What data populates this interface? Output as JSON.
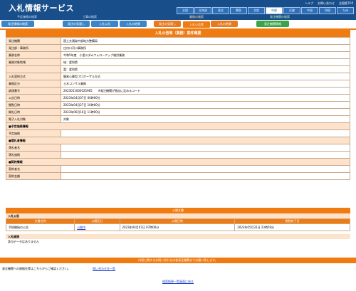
{
  "header": {
    "title": "入札情報サービス",
    "links": [
      "ヘルプ",
      "お問い合わせ",
      "全国版TOP"
    ],
    "regions": [
      "全国",
      "北海道",
      "東北",
      "関東",
      "北陸",
      "中部",
      "近畿",
      "中国",
      "四国",
      "九州"
    ]
  },
  "search_groups": [
    {
      "label": "予定価格の検索"
    },
    {
      "label": "工事の検索"
    },
    {
      "label": "業務の検索"
    },
    {
      "label": "発注機関の検索"
    }
  ],
  "nav": [
    "発注情報の検索",
    "発注の見通し",
    "入札公告",
    "入札の結果",
    "入札公告等",
    "入札の結果",
    "発注の見通し",
    "発注機関情報"
  ],
  "detail": {
    "title": "入札公告等（業務）案件概要",
    "rows": [
      {
        "k": "発注機関",
        "v": "国土交通省中部地方整備局"
      },
      {
        "k": "発注部・事務所",
        "v": "庄内川河川事務所"
      },
      {
        "k": "業務名称",
        "v": "令和5年度　小里川ダムフォローアップ検討業務"
      },
      {
        "k": "業務対象地域",
        "v": "岐：愛知県"
      },
      {
        "k": "",
        "v": "富：愛知県"
      },
      {
        "k": "入札契約方式",
        "v": "簡易公募型プロポーザル方式"
      },
      {
        "k": "業務区分",
        "v": "土木コンサル業務"
      },
      {
        "k": "調達番号",
        "v": "2023051000025965　　※発注機関が独自に定めるコード"
      },
      {
        "k": "公告日時",
        "v": "2023年04月07日 00時00分"
      },
      {
        "k": "閲覧日時",
        "v": "2023年04月27日 10時00分"
      },
      {
        "k": "開札日時",
        "v": "2023年06月16日 11時00分"
      },
      {
        "k": "電子入札対象",
        "v": "対象"
      }
    ],
    "sections": [
      {
        "title": "■予定価格情報",
        "rows": [
          {
            "k": "予定価格",
            "v": ""
          }
        ]
      },
      {
        "title": "■落札者情報",
        "rows": [
          {
            "k": "落札者名",
            "v": ""
          },
          {
            "k": "落札価格",
            "v": ""
          }
        ]
      },
      {
        "title": "■契約情報",
        "rows": [
          {
            "k": "契約者名",
            "v": ""
          },
          {
            "k": "契約金額",
            "v": ""
          }
        ]
      }
    ]
  },
  "docs": {
    "title": "公開文書",
    "notice_label": "入札公告",
    "headers": [
      "文書名称",
      "公開区分",
      "公開日時",
      "閲覧終了日"
    ],
    "row": [
      "手続開始の公告",
      "公開中",
      "2023年04月07日 07時00分",
      "2023年05月31日 23時59分"
    ],
    "results_label": "入札経過",
    "no_data": "該当データはありません"
  },
  "inquiry": {
    "title": "内容に関するお問い合わせは各発注機関までお願い致します。",
    "text": "発注機関への連絡先等はこちらからご確認ください。",
    "link": "問い合わせ先一覧"
  },
  "footer_link": "検索結果一覧画面に戻る"
}
